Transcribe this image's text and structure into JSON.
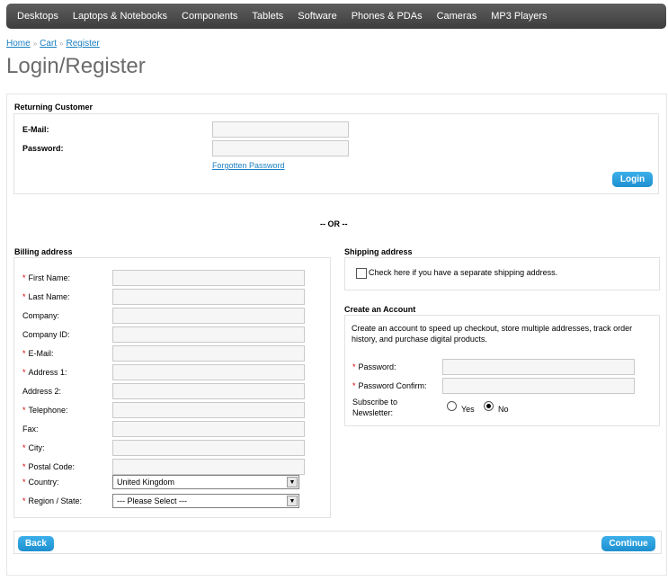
{
  "menu": [
    "Desktops",
    "Laptops & Notebooks",
    "Components",
    "Tablets",
    "Software",
    "Phones & PDAs",
    "Cameras",
    "MP3 Players"
  ],
  "breadcrumb": {
    "home": "Home",
    "cart": "Cart",
    "register": "Register",
    "separator": "»"
  },
  "page_title": "Login/Register",
  "returning": {
    "heading": "Returning Customer",
    "email_label": "E-Mail:",
    "password_label": "Password:",
    "forgotten": "Forgotten Password",
    "login_button": "Login"
  },
  "or_text": "-- OR --",
  "billing": {
    "heading": "Billing address",
    "fields": [
      {
        "label": "First Name:",
        "required": true
      },
      {
        "label": "Last Name:",
        "required": true
      },
      {
        "label": "Company:",
        "required": false
      },
      {
        "label": "Company ID:",
        "required": false
      },
      {
        "label": "E-Mail:",
        "required": true
      },
      {
        "label": "Address 1:",
        "required": true
      },
      {
        "label": "Address 2:",
        "required": false
      },
      {
        "label": "Telephone:",
        "required": true
      },
      {
        "label": "Fax:",
        "required": false
      },
      {
        "label": "City:",
        "required": true
      },
      {
        "label": "Postal Code:",
        "required": true
      }
    ],
    "country_label": "Country:",
    "country_value": "United Kingdom",
    "region_label": "Region / State:",
    "region_value": "--- Please Select ---"
  },
  "shipping": {
    "heading": "Shipping address",
    "checkbox_label": "Check here if you have a separate shipping address."
  },
  "account": {
    "heading": "Create an Account",
    "description_line1": "Create an account to speed up checkout, store multiple addresses, track order",
    "description_line2": "history, and purchase digital products.",
    "password_label": "Password:",
    "confirm_label": "Password Confirm:",
    "subscribe_line1": "Subscribe to",
    "subscribe_line2": "Newsletter:",
    "yes_label": "Yes",
    "no_label": "No",
    "newsletter_value": "No"
  },
  "buttons": {
    "back": "Back",
    "continue": "Continue"
  },
  "colors": {
    "menu_bg": "#4a4a4a",
    "button": "#2a9fdc",
    "required": "#d50000",
    "link": "#1a7fc1",
    "title": "#6b6b6b"
  },
  "icons": {
    "select_arrow": "chevron-down-icon"
  }
}
